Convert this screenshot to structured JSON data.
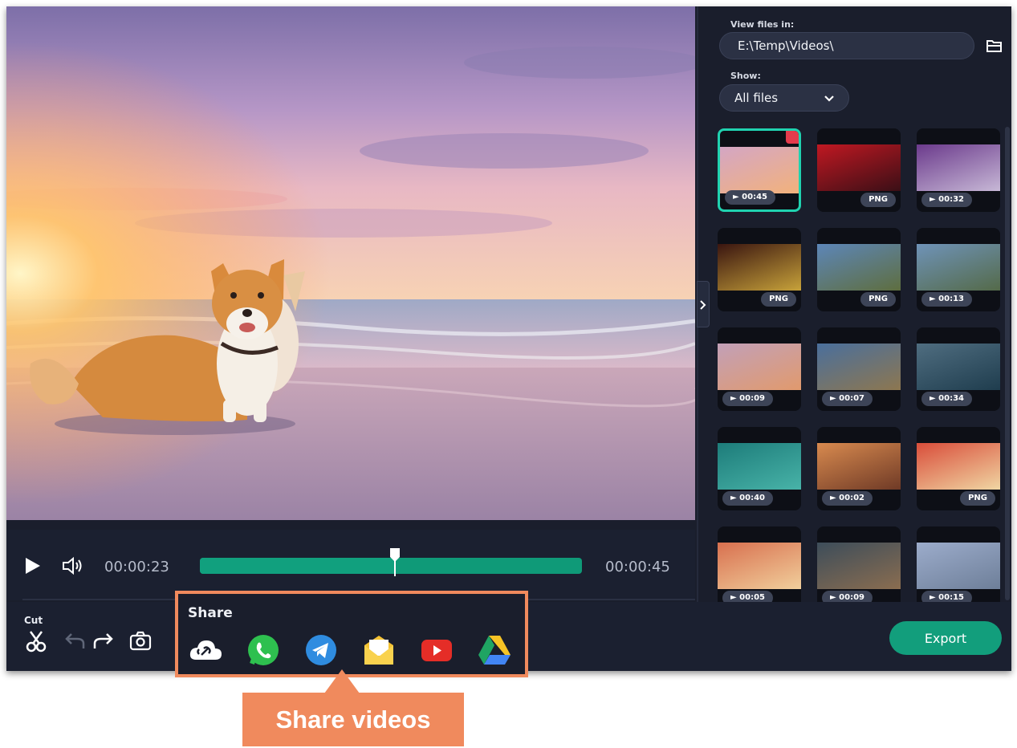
{
  "player": {
    "current_time": "00:00:23",
    "total_time": "00:00:45",
    "progress": 0.51
  },
  "toolbar": {
    "cut_label": "Cut",
    "export_label": "Export"
  },
  "files_panel": {
    "view_label": "View files in:",
    "path": "E:\\Temp\\Videos\\",
    "show_label": "Show:",
    "show_value": "All files"
  },
  "thumbnails": [
    {
      "badge": "► 00:45",
      "selected": true
    },
    {
      "badge": "PNG"
    },
    {
      "badge": "► 00:32"
    },
    {
      "badge": "PNG"
    },
    {
      "badge": "PNG"
    },
    {
      "badge": "► 00:13"
    },
    {
      "badge": "► 00:09"
    },
    {
      "badge": "► 00:07"
    },
    {
      "badge": "► 00:34"
    },
    {
      "badge": "► 00:40"
    },
    {
      "badge": "► 00:02"
    },
    {
      "badge": "PNG"
    },
    {
      "badge": "► 00:05"
    },
    {
      "badge": "► 00:09"
    },
    {
      "badge": "► 00:15"
    }
  ],
  "share": {
    "title": "Share",
    "icons": [
      "cloud-link-icon",
      "whatsapp-icon",
      "telegram-icon",
      "email-icon",
      "youtube-icon",
      "google-drive-icon"
    ]
  },
  "callout": {
    "text": "Share videos"
  },
  "colors": {
    "accent": "#129e7c",
    "callout": "#f08a5d",
    "panel_bg": "#1a1e2c"
  }
}
